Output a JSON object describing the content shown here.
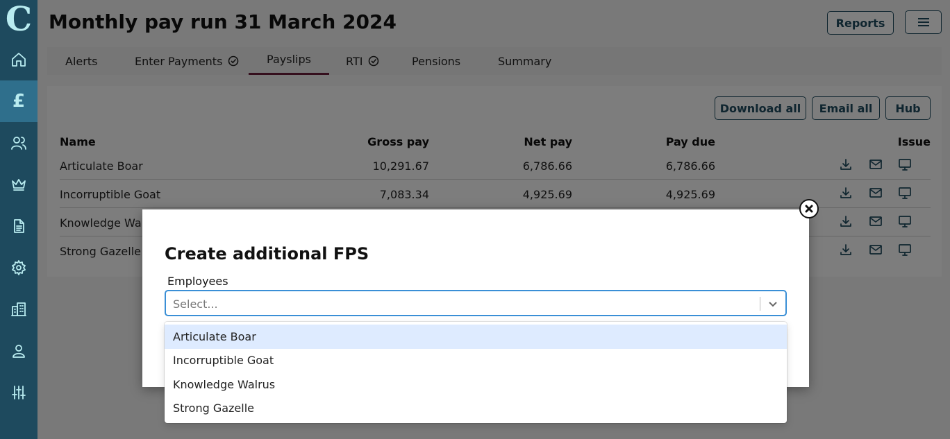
{
  "app": {
    "logo": "C"
  },
  "sidebar": {
    "items": [
      {
        "name": "home",
        "icon": "home-icon"
      },
      {
        "name": "payroll",
        "icon": "pound-icon",
        "active": true,
        "glyph": "£"
      },
      {
        "name": "employees",
        "icon": "users-icon"
      },
      {
        "name": "crown",
        "icon": "crown-icon"
      },
      {
        "name": "documents",
        "icon": "document-icon"
      },
      {
        "name": "settings",
        "icon": "gear-icon"
      },
      {
        "name": "company",
        "icon": "building-icon"
      },
      {
        "name": "account",
        "icon": "user-icon"
      },
      {
        "name": "adjustments",
        "icon": "sliders-icon"
      }
    ]
  },
  "header": {
    "title": "Monthly pay run 31 March 2024",
    "reports_label": "Reports"
  },
  "tabs": [
    {
      "label": "Alerts"
    },
    {
      "label": "Enter Payments",
      "checked": true
    },
    {
      "label": "Payslips",
      "active": true
    },
    {
      "label": "RTI",
      "checked": true
    },
    {
      "label": "Pensions"
    },
    {
      "label": "Summary"
    }
  ],
  "actions": {
    "download_all": "Download all",
    "email_all": "Email all",
    "hub": "Hub"
  },
  "table": {
    "columns": [
      "Name",
      "Gross pay",
      "Net pay",
      "Pay due",
      "Issue"
    ],
    "rows": [
      {
        "name": "Articulate Boar",
        "gross": "10,291.67",
        "net": "6,786.66",
        "due": "6,786.66"
      },
      {
        "name": "Incorruptible Goat",
        "gross": "7,083.34",
        "net": "4,925.69",
        "due": "4,925.69"
      },
      {
        "name": "Knowledge Walrus",
        "gross": "",
        "net": "",
        "due": ""
      },
      {
        "name": "Strong Gazelle",
        "gross": "",
        "net": "",
        "due": ""
      }
    ]
  },
  "modal": {
    "title": "Create additional FPS",
    "field_label": "Employees",
    "placeholder": "Select...",
    "options": [
      "Articulate Boar",
      "Incorruptible Goat",
      "Knowledge Walrus",
      "Strong Gazelle"
    ],
    "focused_option": 0
  },
  "colors": {
    "sidebar_bg": "#1e4a5e",
    "sidebar_active": "#2f6f8c",
    "accent_text": "#1e4a5e",
    "tab_active_underline": "#6a1e3a",
    "select_focus": "#3a8fd6",
    "option_focus": "#deebff"
  }
}
